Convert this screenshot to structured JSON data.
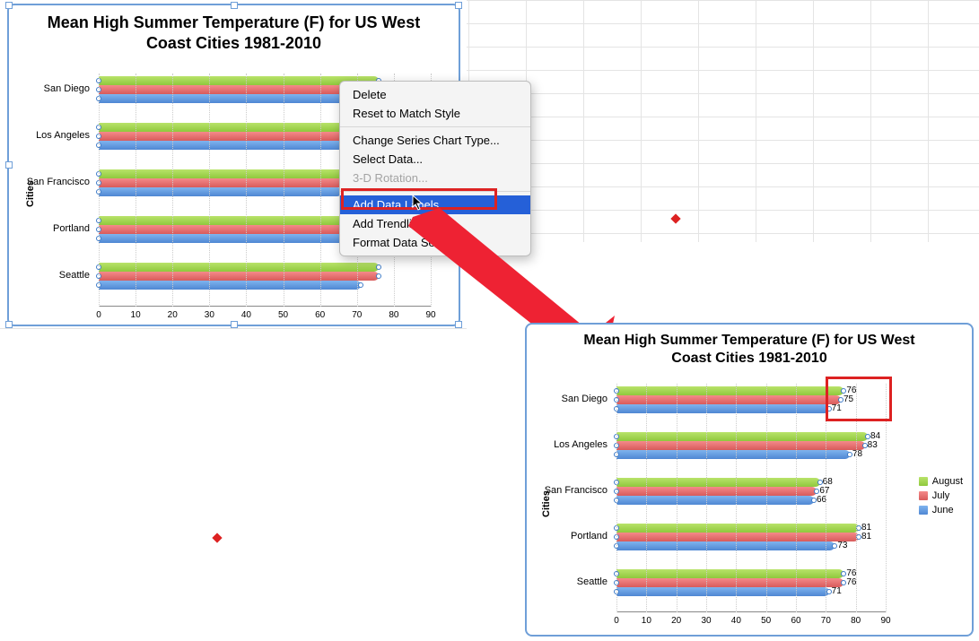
{
  "chart_data": [
    {
      "id": "chart-left",
      "type": "bar",
      "orientation": "horizontal",
      "title": "Mean High Summer Temperature (F) for US West Coast Cities 1981-2010",
      "ylabel": "Cities",
      "xlabel": "",
      "xlim": [
        0,
        90
      ],
      "xticks": [
        0,
        10,
        20,
        30,
        40,
        50,
        60,
        70,
        80,
        90
      ],
      "categories": [
        "Seattle",
        "Portland",
        "San Francisco",
        "Los Angeles",
        "San Diego"
      ],
      "series": [
        {
          "name": "June",
          "values": [
            71,
            73,
            66,
            78,
            71
          ]
        },
        {
          "name": "July",
          "values": [
            76,
            81,
            67,
            83,
            75
          ]
        },
        {
          "name": "August",
          "values": [
            76,
            81,
            68,
            84,
            76
          ]
        }
      ],
      "has_data_labels": false,
      "series_selected": "August",
      "show_handles": true,
      "show_legend": false
    },
    {
      "id": "chart-right",
      "type": "bar",
      "orientation": "horizontal",
      "title": "Mean High Summer Temperature (F) for US West Coast Cities 1981-2010",
      "ylabel": "Cities",
      "xlabel": "",
      "xlim": [
        0,
        90
      ],
      "xticks": [
        0,
        10,
        20,
        30,
        40,
        50,
        60,
        70,
        80,
        90
      ],
      "categories": [
        "Seattle",
        "Portland",
        "San Francisco",
        "Los Angeles",
        "San Diego"
      ],
      "series": [
        {
          "name": "June",
          "values": [
            71,
            73,
            66,
            78,
            71
          ]
        },
        {
          "name": "July",
          "values": [
            76,
            81,
            67,
            83,
            75
          ]
        },
        {
          "name": "August",
          "values": [
            76,
            81,
            68,
            84,
            76
          ]
        }
      ],
      "has_data_labels": true,
      "show_handles": true,
      "show_legend": true,
      "legend_order": [
        "August",
        "July",
        "June"
      ]
    }
  ],
  "context_menu": {
    "items": [
      {
        "label": "Delete",
        "enabled": true,
        "highlight": false
      },
      {
        "label": "Reset to Match Style",
        "enabled": true,
        "highlight": false
      },
      {
        "sep": true
      },
      {
        "label": "Change Series Chart Type...",
        "enabled": true,
        "highlight": false
      },
      {
        "label": "Select Data...",
        "enabled": true,
        "highlight": false
      },
      {
        "label": "3-D Rotation...",
        "enabled": false,
        "highlight": false
      },
      {
        "sep": true
      },
      {
        "label": "Add Data Labels",
        "enabled": true,
        "highlight": true
      },
      {
        "label": "Add Trendline...",
        "enabled": true,
        "highlight": false
      },
      {
        "label": "Format Data Series...",
        "enabled": true,
        "highlight": false
      }
    ]
  },
  "annotations": {
    "red_box_menu": true,
    "red_box_labels": true,
    "arrow": true
  }
}
